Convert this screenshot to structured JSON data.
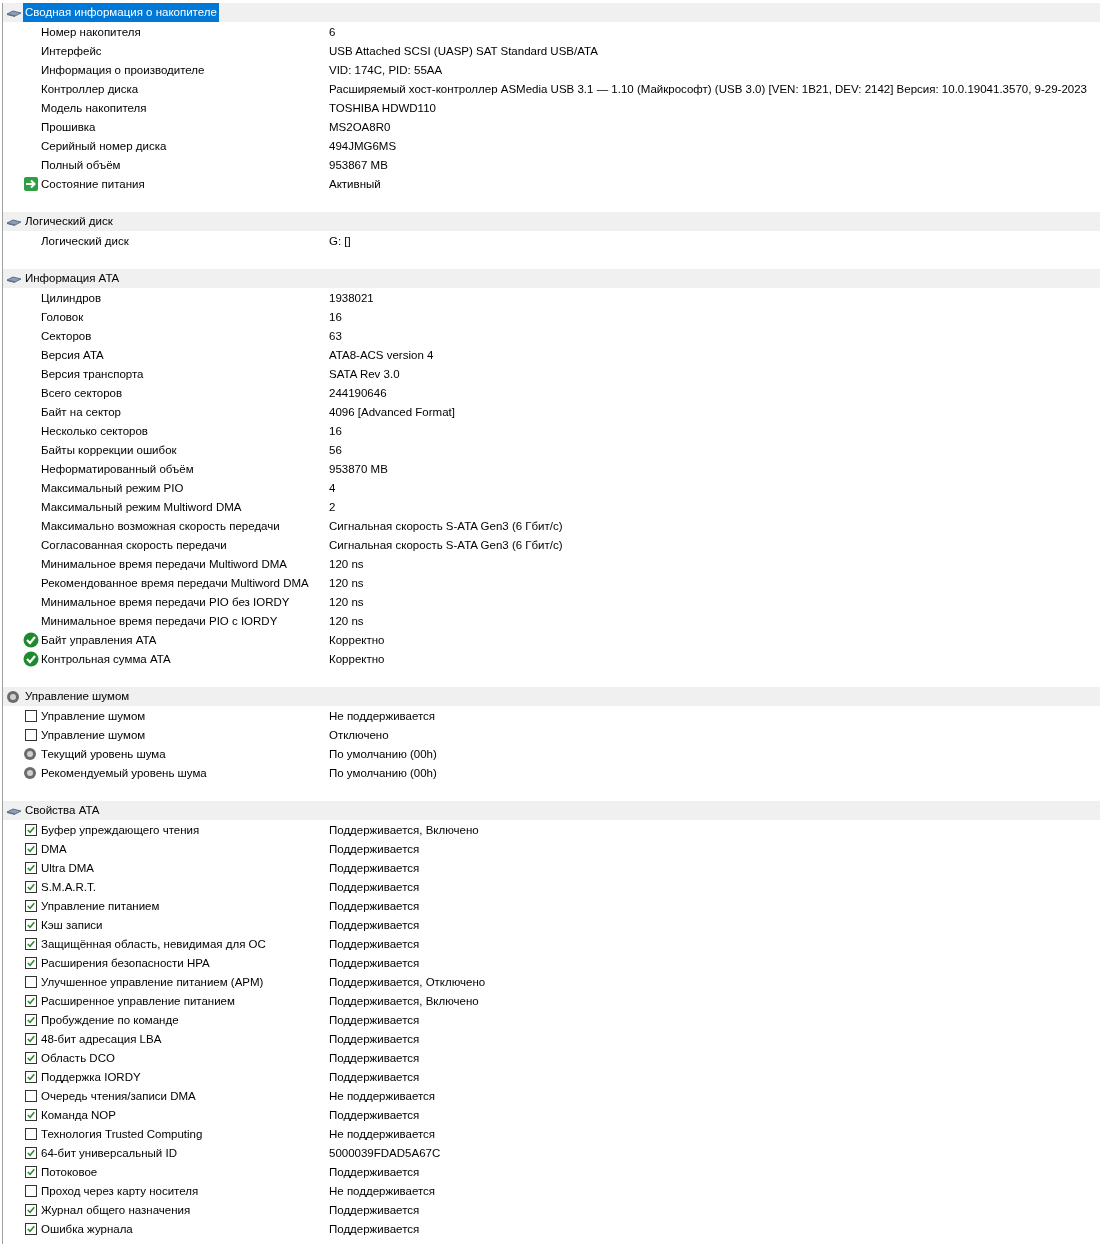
{
  "sections": [
    {
      "title": "Сводная информация о накопителе",
      "kind": "drive",
      "selected": true,
      "rows": [
        {
          "kind": "plain",
          "label": "Номер накопителя",
          "value": "6"
        },
        {
          "kind": "plain",
          "label": "Интерфейс",
          "value": "USB Attached SCSI (UASP) SAT Standard USB/ATA"
        },
        {
          "kind": "plain",
          "label": "Информация о производителе",
          "value": "VID: 174C, PID: 55AA"
        },
        {
          "kind": "plain",
          "label": "Контроллер диска",
          "value": "Расширяемый хост-контроллер ASMedia USB 3.1 — 1.10 (Майкрософт) (USB 3.0) [VEN: 1B21, DEV: 2142] Версия: 10.0.19041.3570, 9-29-2023"
        },
        {
          "kind": "plain",
          "label": "Модель накопителя",
          "value": "TOSHIBA HDWD110"
        },
        {
          "kind": "plain",
          "label": "Прошивка",
          "value": "MS2OA8R0"
        },
        {
          "kind": "plain",
          "label": "Серийный номер диска",
          "value": "494JMG6MS"
        },
        {
          "kind": "plain",
          "label": "Полный объём",
          "value": "953867 MB"
        },
        {
          "kind": "arrow",
          "label": "Состояние питания",
          "value": "Активный"
        }
      ]
    },
    {
      "title": "Логический диск",
      "kind": "drive",
      "selected": false,
      "rows": [
        {
          "kind": "plain",
          "label": "Логический диск",
          "value": "G: []"
        }
      ]
    },
    {
      "title": "Информация ATA",
      "kind": "drive",
      "selected": false,
      "rows": [
        {
          "kind": "plain",
          "label": "Цилиндров",
          "value": "1938021"
        },
        {
          "kind": "plain",
          "label": "Головок",
          "value": "16"
        },
        {
          "kind": "plain",
          "label": "Секторов",
          "value": "63"
        },
        {
          "kind": "plain",
          "label": "Версия ATA",
          "value": "ATA8-ACS version 4"
        },
        {
          "kind": "plain",
          "label": "Версия транспорта",
          "value": "SATA Rev 3.0"
        },
        {
          "kind": "plain",
          "label": "Всего секторов",
          "value": "244190646"
        },
        {
          "kind": "plain",
          "label": "Байт на сектор",
          "value": "4096 [Advanced Format]"
        },
        {
          "kind": "plain",
          "label": "Несколько секторов",
          "value": "16"
        },
        {
          "kind": "plain",
          "label": "Байты коррекции ошибок",
          "value": "56"
        },
        {
          "kind": "plain",
          "label": "Неформатированный объём",
          "value": "953870 MB"
        },
        {
          "kind": "plain",
          "label": "Максимальный режим PIO",
          "value": "4"
        },
        {
          "kind": "plain",
          "label": "Максимальный режим Multiword DMA",
          "value": "2"
        },
        {
          "kind": "plain",
          "label": "Максимально возможная скорость передачи",
          "value": "Сигнальная скорость S-ATA Gen3 (6 Гбит/с)"
        },
        {
          "kind": "plain",
          "label": "Согласованная скорость передачи",
          "value": "Сигнальная скорость S-ATA Gen3 (6 Гбит/с)"
        },
        {
          "kind": "plain",
          "label": "Минимальное время передачи Multiword DMA",
          "value": "120 ns"
        },
        {
          "kind": "plain",
          "label": "Рекомендованное время передачи Multiword DMA",
          "value": "120 ns"
        },
        {
          "kind": "plain",
          "label": "Минимальное время передачи PIO без IORDY",
          "value": "120 ns"
        },
        {
          "kind": "plain",
          "label": "Минимальное время передачи PIO с IORDY",
          "value": "120 ns"
        },
        {
          "kind": "ok",
          "label": "Байт управления ATA",
          "value": "Корректно"
        },
        {
          "kind": "ok",
          "label": "Контрольная сумма ATA",
          "value": "Корректно"
        }
      ]
    },
    {
      "title": "Управление шумом",
      "kind": "noise",
      "selected": false,
      "rows": [
        {
          "kind": "checkbox",
          "checked": false,
          "label": "Управление шумом",
          "value": "Не поддерживается"
        },
        {
          "kind": "checkbox",
          "checked": false,
          "label": "Управление шумом",
          "value": "Отключено"
        },
        {
          "kind": "noise",
          "label": "Текущий уровень шума",
          "value": "По умолчанию (00h)"
        },
        {
          "kind": "noise",
          "label": "Рекомендуемый уровень шума",
          "value": "По умолчанию (00h)"
        }
      ]
    },
    {
      "title": "Свойства ATA",
      "kind": "drive",
      "selected": false,
      "rows": [
        {
          "kind": "checkbox",
          "checked": true,
          "label": "Буфер упреждающего чтения",
          "value": "Поддерживается, Включено"
        },
        {
          "kind": "checkbox",
          "checked": true,
          "label": "DMA",
          "value": "Поддерживается"
        },
        {
          "kind": "checkbox",
          "checked": true,
          "label": "Ultra DMA",
          "value": "Поддерживается"
        },
        {
          "kind": "checkbox",
          "checked": true,
          "label": "S.M.A.R.T.",
          "value": "Поддерживается"
        },
        {
          "kind": "checkbox",
          "checked": true,
          "label": "Управление питанием",
          "value": "Поддерживается"
        },
        {
          "kind": "checkbox",
          "checked": true,
          "label": "Кэш записи",
          "value": "Поддерживается"
        },
        {
          "kind": "checkbox",
          "checked": true,
          "label": "Защищённая область, невидимая для ОС",
          "value": "Поддерживается"
        },
        {
          "kind": "checkbox",
          "checked": true,
          "label": "Расширения безопасности HPA",
          "value": "Поддерживается"
        },
        {
          "kind": "checkbox",
          "checked": false,
          "label": "Улучшенное управление питанием (APM)",
          "value": "Поддерживается, Отключено"
        },
        {
          "kind": "checkbox",
          "checked": true,
          "label": "Расширенное управление питанием",
          "value": "Поддерживается, Включено"
        },
        {
          "kind": "checkbox",
          "checked": true,
          "label": "Пробуждение по команде",
          "value": "Поддерживается"
        },
        {
          "kind": "checkbox",
          "checked": true,
          "label": "48-бит адресация LBA",
          "value": "Поддерживается"
        },
        {
          "kind": "checkbox",
          "checked": true,
          "label": "Область DCO",
          "value": "Поддерживается"
        },
        {
          "kind": "checkbox",
          "checked": true,
          "label": "Поддержка IORDY",
          "value": "Поддерживается"
        },
        {
          "kind": "checkbox",
          "checked": false,
          "label": "Очередь чтения/записи DMA",
          "value": "Не поддерживается"
        },
        {
          "kind": "checkbox",
          "checked": true,
          "label": "Команда NOP",
          "value": "Поддерживается"
        },
        {
          "kind": "checkbox",
          "checked": false,
          "label": "Технология Trusted Computing",
          "value": "Не поддерживается"
        },
        {
          "kind": "checkbox",
          "checked": true,
          "label": "64-бит универсальный ID",
          "value": "5000039FDAD5A67C"
        },
        {
          "kind": "checkbox",
          "checked": true,
          "label": "Потоковое",
          "value": "Поддерживается"
        },
        {
          "kind": "checkbox",
          "checked": false,
          "label": "Проход через карту носителя",
          "value": "Не поддерживается"
        },
        {
          "kind": "checkbox",
          "checked": true,
          "label": "Журнал общего назначения",
          "value": "Поддерживается"
        },
        {
          "kind": "checkbox",
          "checked": true,
          "label": "Ошибка журнала",
          "value": "Поддерживается"
        }
      ]
    }
  ]
}
